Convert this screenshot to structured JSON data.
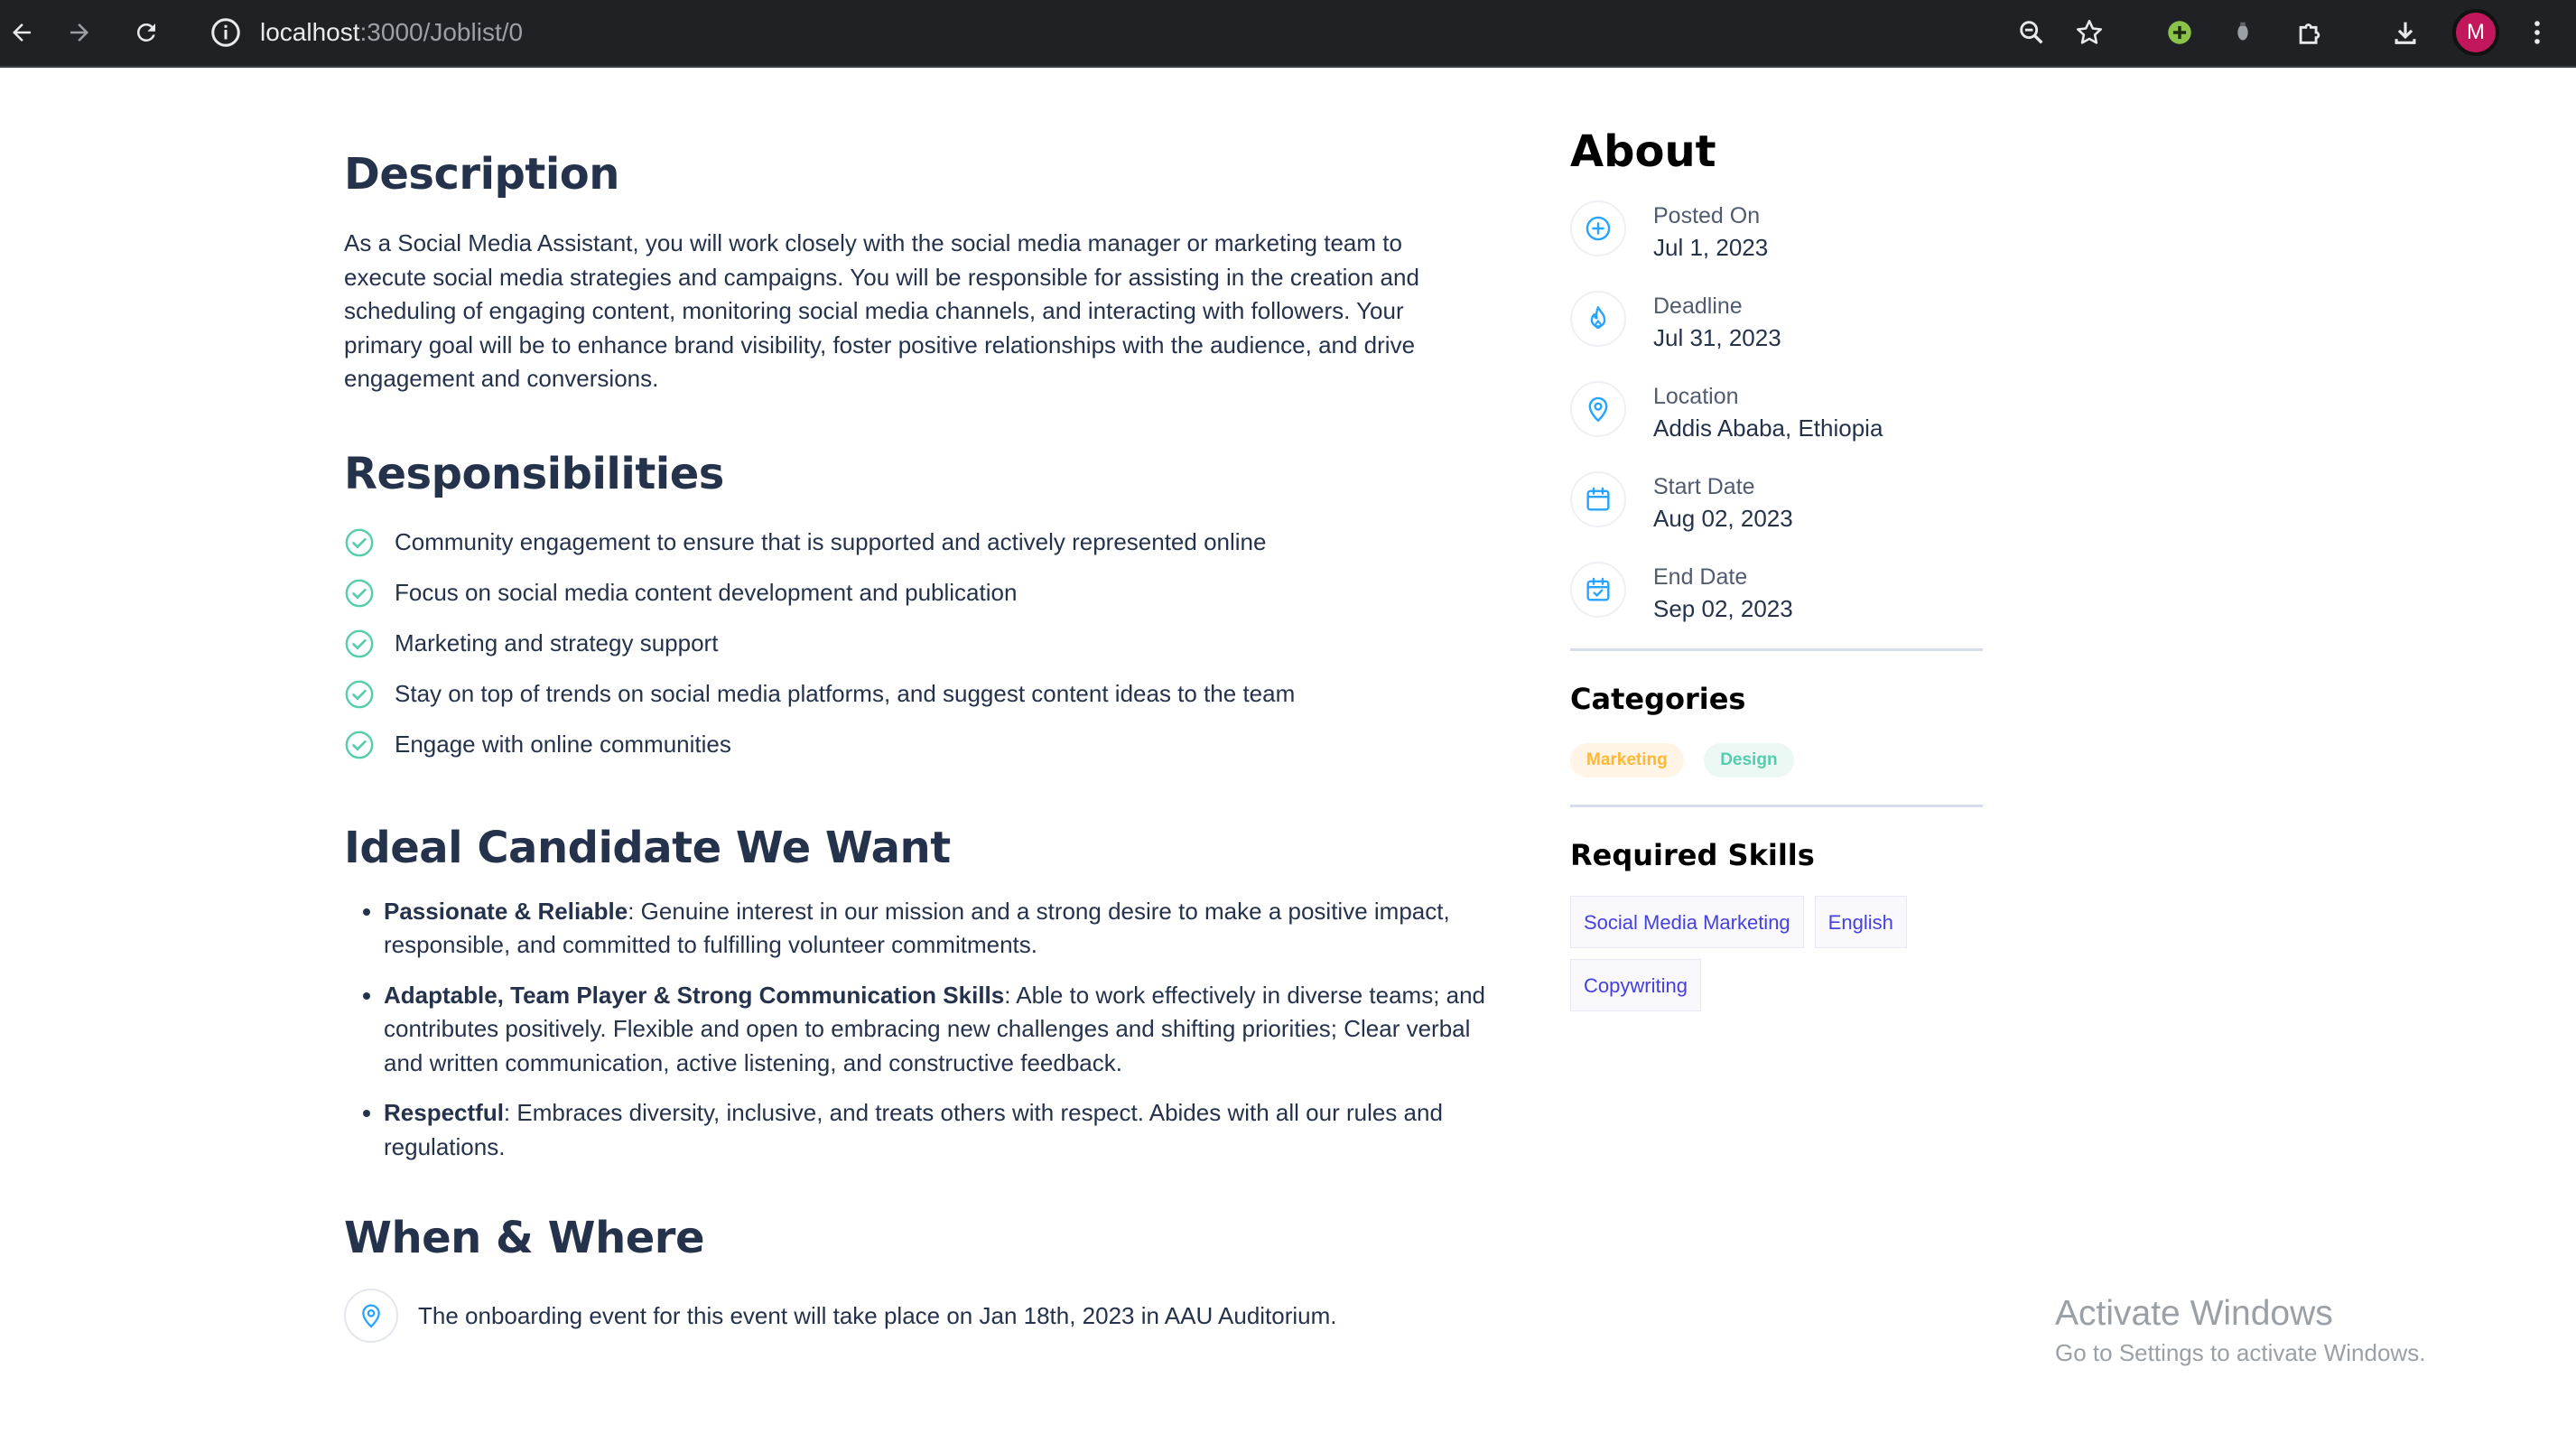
{
  "browser": {
    "url_host": "localhost",
    "url_path": ":3000/Joblist/0",
    "profile_initial": "M"
  },
  "description": {
    "heading": "Description",
    "text": "As a Social Media Assistant, you will work closely with the social media manager or marketing team to execute social media strategies and campaigns. You will be responsible for assisting in the creation and scheduling of engaging content, monitoring social media channels, and interacting with followers. Your primary goal will be to enhance brand visibility, foster positive relationships with the audience, and drive engagement and conversions."
  },
  "responsibilities": {
    "heading": "Responsibilities",
    "items": [
      "Community engagement to ensure that is supported and actively represented online",
      "Focus on social media content development and publication",
      "Marketing and strategy support",
      "Stay on top of trends on social media platforms, and suggest content ideas to the team",
      "Engage with online communities"
    ]
  },
  "ideal_candidate": {
    "heading": "Ideal Candidate We Want",
    "items": [
      {
        "title": "Passionate & Reliable",
        "text": ": Genuine interest in our mission and a strong desire to make a positive impact, responsible, and committed to fulfilling volunteer commitments."
      },
      {
        "title": "Adaptable, Team Player & Strong Communication Skills",
        "text": ": Able to work effectively in diverse teams; and contributes positively. Flexible and open to embracing new challenges and shifting priorities; Clear verbal and written communication, active listening, and constructive feedback."
      },
      {
        "title": "Respectful",
        "text": ": Embraces diversity, inclusive, and treats others with respect. Abides with all our rules and regulations."
      }
    ]
  },
  "when_where": {
    "heading": "When & Where",
    "text": "The onboarding event for this event will take place on Jan 18th, 2023 in AAU Auditorium."
  },
  "about": {
    "heading": "About",
    "items": [
      {
        "label": "Posted On",
        "value": "Jul 1, 2023",
        "icon": "plus-circle-icon"
      },
      {
        "label": "Deadline",
        "value": "Jul 31, 2023",
        "icon": "fire-icon"
      },
      {
        "label": "Location",
        "value": "Addis Ababa, Ethiopia",
        "icon": "location-pin-icon"
      },
      {
        "label": "Start Date",
        "value": "Aug 02, 2023",
        "icon": "calendar-icon"
      },
      {
        "label": "End Date",
        "value": "Sep 02, 2023",
        "icon": "calendar-check-icon"
      }
    ]
  },
  "categories": {
    "heading": "Categories",
    "items": [
      {
        "label": "Marketing",
        "color": "#FFB836",
        "bg": "#FFF4E5"
      },
      {
        "label": "Design",
        "color": "#56CDAD",
        "bg": "#EBF8F4"
      }
    ]
  },
  "skills": {
    "heading": "Required Skills",
    "items": [
      "Social Media Marketing",
      "English",
      "Copywriting"
    ]
  },
  "watermark": {
    "line1": "Activate Windows",
    "line2": "Go to Settings to activate Windows."
  },
  "colors": {
    "accent_icon": "#26A4FF",
    "check_green": "#56CDAD",
    "text_dark": "#25324B",
    "link_purple": "#4640DE"
  }
}
